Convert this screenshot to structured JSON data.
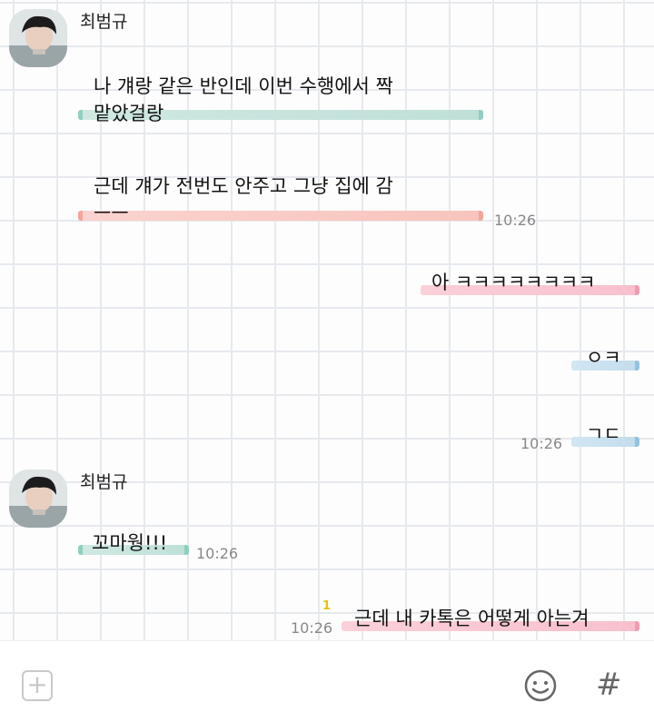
{
  "chat": {
    "groups": [
      {
        "sender": "최범규",
        "messages": [
          {
            "text": "나 걔랑 같은 반인데 이번 수행에서 짝\n맡았걸랑",
            "time": "",
            "highlight": "#bfe0d8"
          },
          {
            "text": "근데 걔가 전번도 안주고 그냥 집에 감\nㅡㅡ",
            "time": "10:26",
            "highlight": "#f8c4bd"
          }
        ]
      },
      {
        "sender": "me",
        "messages": [
          {
            "text": "아 ㅋㅋㅋㅋㅋㅋㅋㅋ",
            "time": "",
            "highlight": "#f8c0cd"
          },
          {
            "text": "ㅇㅋ",
            "time": "",
            "highlight": "#c3ddee"
          },
          {
            "text": "ㄱㄷ",
            "time": "10:26",
            "highlight": "#c3ddee"
          }
        ]
      },
      {
        "sender": "최범규",
        "messages": [
          {
            "text": "꼬마웡!!!",
            "time": "10:26",
            "highlight": "#bfe0d8"
          }
        ]
      },
      {
        "sender": "me",
        "messages": [
          {
            "text": "근데 내 카톡은 어떻게 아는겨",
            "time": "10:26",
            "unread": "1",
            "highlight": "#f8c0cd"
          }
        ]
      }
    ]
  },
  "input_bar": {
    "add_icon": "plus-square-icon",
    "emoji_icon": "smiley-icon",
    "hash_icon": "hash-icon",
    "hash_label": "#"
  }
}
